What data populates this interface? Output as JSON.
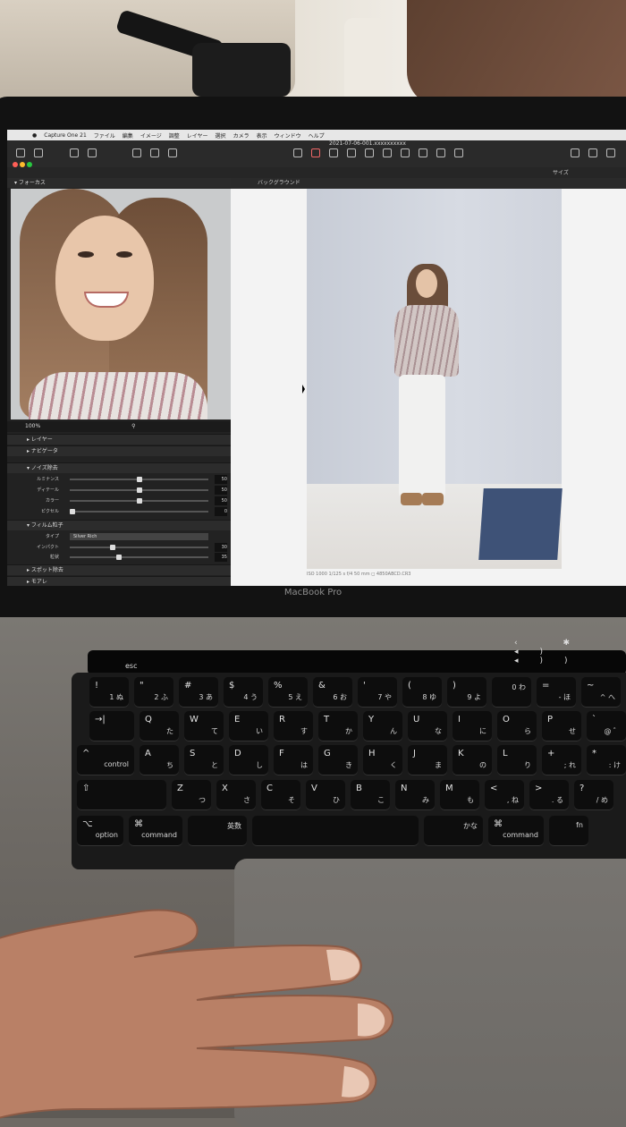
{
  "app": {
    "menubar": [
      "Capture One 21",
      "ファイル",
      "編集",
      "イメージ",
      "調整",
      "レイヤー",
      "選択",
      "カメラ",
      "表示",
      "ウィンドウ",
      "ヘルプ"
    ],
    "document_title": "2021-07-06-001.xxxxxxxxxx",
    "toolbar_right_label": "サイズ",
    "traffic_colors": [
      "#ff5f57",
      "#febc2e",
      "#28c840"
    ]
  },
  "left_panel": {
    "focus_title": "フォーカス",
    "zoom_level": "100%",
    "sections": [
      {
        "title": "レイヤー"
      },
      {
        "title": "ナビゲータ"
      },
      {
        "title": "ノイズ除去"
      },
      {
        "title": "フィルム粒子"
      },
      {
        "title": "スポット除去"
      },
      {
        "title": "モアレ"
      }
    ],
    "noise_sliders": [
      {
        "label": "ルミナンス",
        "value": "50",
        "level": 0.5
      },
      {
        "label": "ディテール",
        "value": "50",
        "level": 0.5
      },
      {
        "label": "カラー",
        "value": "50",
        "level": 0.5
      },
      {
        "label": "ピクセル",
        "value": "0",
        "level": 0.0
      }
    ],
    "film_grain": {
      "type_label": "タイプ",
      "type_value": "Silver Rich",
      "sliders": [
        {
          "label": "インパクト",
          "value": "30",
          "level": 0.3
        },
        {
          "label": "粒状",
          "value": "35",
          "level": 0.35
        }
      ]
    }
  },
  "viewer": {
    "header_label": "バックグラウンド",
    "caption": "ISO 1000    1/125 s    f/4    50 mm              ◻ 4850ABCD.CR3"
  },
  "laptop": {
    "brand": "MacBook Pro",
    "touchbar_esc": "esc",
    "keyboard_rows": [
      [
        {
          "m": "!",
          "s": "1 ぬ"
        },
        {
          "m": "\"",
          "s": "2 ふ"
        },
        {
          "m": "#",
          "s": "3 あ"
        },
        {
          "m": "$",
          "s": "4 う"
        },
        {
          "m": "%",
          "s": "5 え"
        },
        {
          "m": "&",
          "s": "6 お"
        },
        {
          "m": "'",
          "s": "7 や"
        },
        {
          "m": "(",
          "s": "8 ゆ"
        },
        {
          "m": ")",
          "s": "9 よ"
        },
        {
          "m": "",
          "s": "0 わ"
        },
        {
          "m": "=",
          "s": "- ほ"
        },
        {
          "m": "~",
          "s": "^ へ"
        }
      ],
      [
        {
          "m": "→|",
          "s": ""
        },
        {
          "m": "Q",
          "s": "た"
        },
        {
          "m": "W",
          "s": "て"
        },
        {
          "m": "E",
          "s": "い"
        },
        {
          "m": "R",
          "s": "す"
        },
        {
          "m": "T",
          "s": "か"
        },
        {
          "m": "Y",
          "s": "ん"
        },
        {
          "m": "U",
          "s": "な"
        },
        {
          "m": "I",
          "s": "に"
        },
        {
          "m": "O",
          "s": "ら"
        },
        {
          "m": "P",
          "s": "せ"
        },
        {
          "m": "`",
          "s": "@ ゛"
        }
      ],
      [
        {
          "m": "^",
          "s": "control"
        },
        {
          "m": "A",
          "s": "ち"
        },
        {
          "m": "S",
          "s": "と"
        },
        {
          "m": "D",
          "s": "し"
        },
        {
          "m": "F",
          "s": "は"
        },
        {
          "m": "G",
          "s": "き"
        },
        {
          "m": "H",
          "s": "く"
        },
        {
          "m": "J",
          "s": "ま"
        },
        {
          "m": "K",
          "s": "の"
        },
        {
          "m": "L",
          "s": "り"
        },
        {
          "m": "+",
          "s": "; れ"
        },
        {
          "m": "*",
          "s": ": け"
        }
      ],
      [
        {
          "m": "⇧",
          "s": ""
        },
        {
          "m": "Z",
          "s": "つ"
        },
        {
          "m": "X",
          "s": "さ"
        },
        {
          "m": "C",
          "s": "そ"
        },
        {
          "m": "V",
          "s": "ひ"
        },
        {
          "m": "B",
          "s": "こ"
        },
        {
          "m": "N",
          "s": "み"
        },
        {
          "m": "M",
          "s": "も"
        },
        {
          "m": "<",
          "s": ", ね"
        },
        {
          "m": ">",
          "s": ". る"
        },
        {
          "m": "?",
          "s": "/ め"
        }
      ],
      [
        {
          "m": "⌥",
          "s": "option"
        },
        {
          "m": "⌘",
          "s": "command"
        },
        {
          "m": "",
          "s": "英数"
        },
        {
          "m": "",
          "s": ""
        },
        {
          "m": "",
          "s": "かな"
        },
        {
          "m": "⌘",
          "s": "command"
        },
        {
          "m": "",
          "s": "fn"
        }
      ]
    ]
  }
}
